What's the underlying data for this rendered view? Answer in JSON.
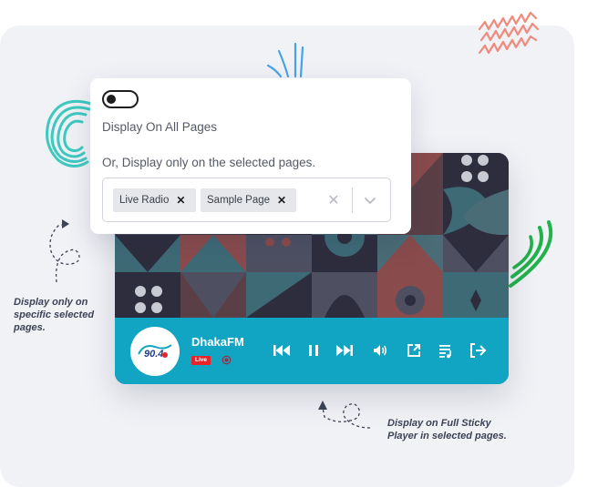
{
  "settings": {
    "toggle_state": "off",
    "display_all_label": "Display On All Pages",
    "display_selected_label": "Or, Display only on the selected pages.",
    "selected_pages": [
      {
        "label": "Live Radio"
      },
      {
        "label": "Sample Page"
      }
    ]
  },
  "player": {
    "station_name": "DhakaFM",
    "live_badge": "Live",
    "accent_color": "#12a4c3",
    "controls": [
      "previous-icon",
      "pause-icon",
      "next-icon",
      "volume-icon",
      "popout-icon",
      "playlist-icon",
      "close-player-icon"
    ]
  },
  "annotations": {
    "left": [
      "Display only on",
      "specific selected",
      "pages."
    ],
    "bottom": [
      "Display on Full Sticky",
      "Player in selected pages."
    ]
  },
  "colors": {
    "live_red": "#e8242b",
    "teal_scribble": "#3ec9c0",
    "green_scribble": "#21b24b",
    "coral_scribble": "#f08a7c",
    "blue_scribble": "#4aa3e8"
  }
}
